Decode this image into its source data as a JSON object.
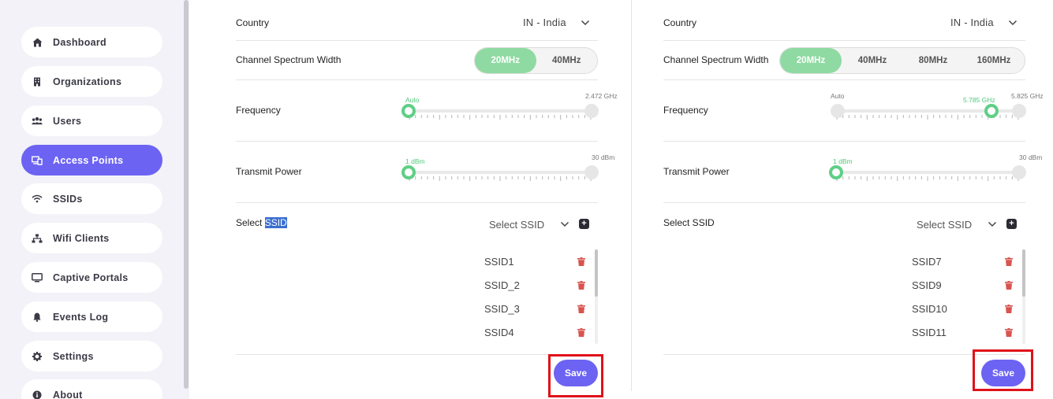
{
  "sidebar": {
    "items": [
      {
        "label": "Dashboard",
        "icon": "home-icon"
      },
      {
        "label": "Organizations",
        "icon": "building-icon"
      },
      {
        "label": "Users",
        "icon": "users-icon"
      },
      {
        "label": "Access Points",
        "icon": "access-point-icon",
        "active": true
      },
      {
        "label": "SSIDs",
        "icon": "wifi-icon"
      },
      {
        "label": "Wifi Clients",
        "icon": "network-icon"
      },
      {
        "label": "Captive Portals",
        "icon": "monitor-icon"
      },
      {
        "label": "Events Log",
        "icon": "bell-icon"
      },
      {
        "label": "Settings",
        "icon": "gear-icon"
      },
      {
        "label": "About",
        "icon": "info-icon"
      }
    ]
  },
  "panel1": {
    "country_label": "Country",
    "country_value": "IN - India",
    "width_label": "Channel Spectrum Width",
    "widths": [
      "20MHz",
      "40MHz"
    ],
    "selected_width": "20MHz",
    "frequency_label": "Frequency",
    "frequency_current": "Auto",
    "frequency_max": "2.472 GHz",
    "frequency_level": 0,
    "power_label": "Transmit Power",
    "power_current": "1 dBm",
    "power_max": "30 dBm",
    "power_level": 0,
    "ssid_label_prefix": "Select ",
    "ssid_label_highlight": "SSID",
    "ssid_placeholder": "Select SSID",
    "ssids": [
      "SSID1",
      "SSID_2",
      "SSID_3",
      "SSID4"
    ],
    "save_label": "Save"
  },
  "panel2": {
    "country_label": "Country",
    "country_value": "IN - India",
    "width_label": "Channel Spectrum Width",
    "widths": [
      "20MHz",
      "40MHz",
      "80MHz",
      "160MHz"
    ],
    "selected_width": "20MHz",
    "frequency_label": "Frequency",
    "frequency_min": "Auto",
    "frequency_current": "5.785 GHz",
    "frequency_max": "5.825 GHz",
    "frequency_level": 0.85,
    "power_label": "Transmit Power",
    "power_current": "1 dBm",
    "power_max": "30 dBm",
    "power_level": 0,
    "ssid_label": "Select SSID",
    "ssid_placeholder": "Select SSID",
    "ssids": [
      "SSID7",
      "SSID9",
      "SSID10",
      "SSID11"
    ],
    "save_label": "Save"
  },
  "colors": {
    "accent": "#6c63f2",
    "green": "#5fcf86",
    "delete": "#d9534f",
    "annotation": "#e0121a"
  }
}
